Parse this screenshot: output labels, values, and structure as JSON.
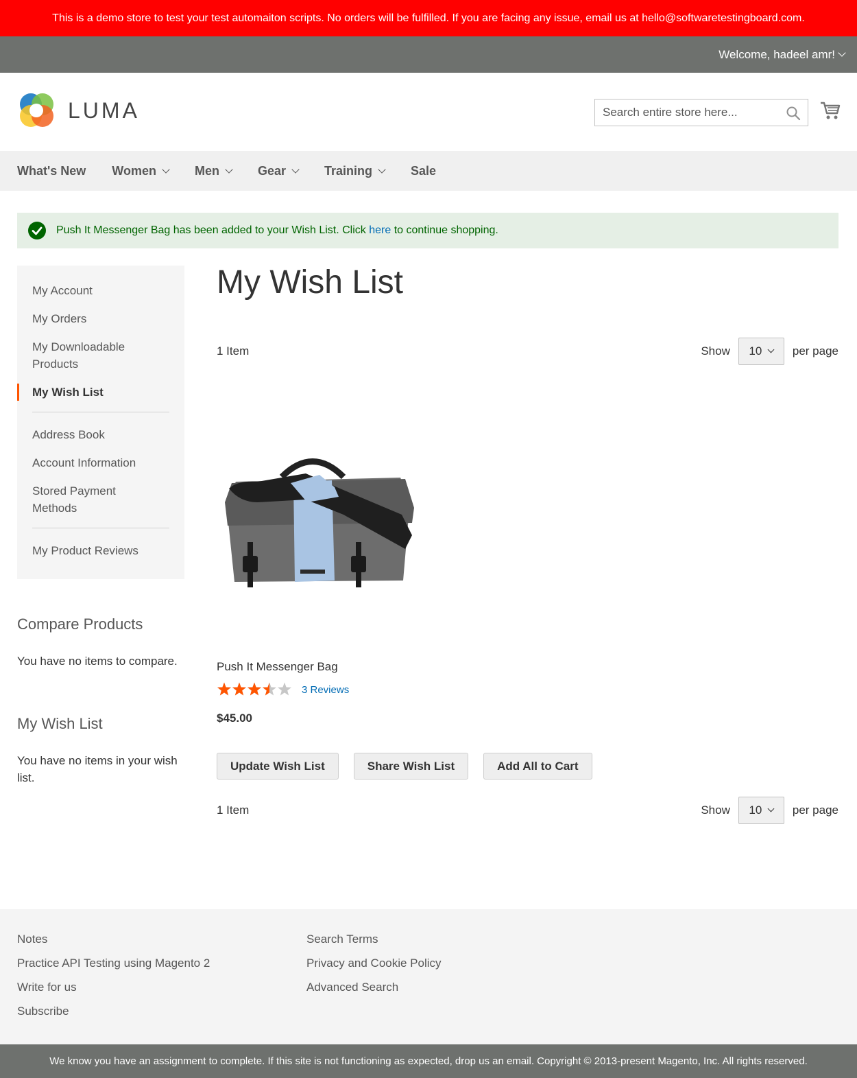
{
  "banner": {
    "text": "This is a demo store to test your test automaiton scripts. No orders will be fulfilled. If you are facing any issue, email us at hello@softwaretestingboard.com."
  },
  "topbar": {
    "welcome": "Welcome, hadeel amr!"
  },
  "header": {
    "logo_text": "LUMA",
    "search_placeholder": "Search entire store here..."
  },
  "nav": {
    "items": [
      {
        "label": "What's New"
      },
      {
        "label": "Women"
      },
      {
        "label": "Men"
      },
      {
        "label": "Gear"
      },
      {
        "label": "Training"
      },
      {
        "label": "Sale"
      }
    ]
  },
  "message": {
    "before": "Push It Messenger Bag has been added to your Wish List. Click ",
    "link": "here",
    "after": " to continue shopping."
  },
  "sidebar": {
    "items": [
      {
        "label": "My Account"
      },
      {
        "label": "My Orders"
      },
      {
        "label": "My Downloadable Products"
      },
      {
        "label": "My Wish List"
      },
      {
        "label": "Address Book"
      },
      {
        "label": "Account Information"
      },
      {
        "label": "Stored Payment Methods"
      },
      {
        "label": "My Product Reviews"
      }
    ]
  },
  "compare": {
    "title": "Compare Products",
    "text": "You have no items to compare."
  },
  "wishlist_block": {
    "title": "My Wish List",
    "text": "You have no items in your wish list."
  },
  "main": {
    "title": "My Wish List",
    "toolbar": {
      "count": "1 Item",
      "show": "Show",
      "limit": "10",
      "per_page": "per page"
    },
    "product": {
      "name": "Push It Messenger Bag",
      "rating_stars": 3.5,
      "reviews": "3 Reviews",
      "price": "$45.00"
    },
    "buttons": {
      "update": "Update Wish List",
      "share": "Share Wish List",
      "add_all": "Add All to Cart"
    }
  },
  "footer": {
    "col1": [
      {
        "label": "Notes"
      },
      {
        "label": "Practice API Testing using Magento 2"
      },
      {
        "label": "Write for us"
      },
      {
        "label": "Subscribe"
      }
    ],
    "col2": [
      {
        "label": "Search Terms"
      },
      {
        "label": "Privacy and Cookie Policy"
      },
      {
        "label": "Advanced Search"
      }
    ]
  },
  "copyright": "We know you have an assignment to complete. If this site is not functioning as expected, drop us an email. Copyright © 2013-present Magento, Inc. All rights reserved.",
  "colors": {
    "banner": "#ff0000",
    "topbar": "#6e716e",
    "active_accent": "#ff5501",
    "star_on": "#ff5501",
    "star_off": "#c7c7c7",
    "link": "#006bb4",
    "success_bg": "#e5efe5"
  }
}
